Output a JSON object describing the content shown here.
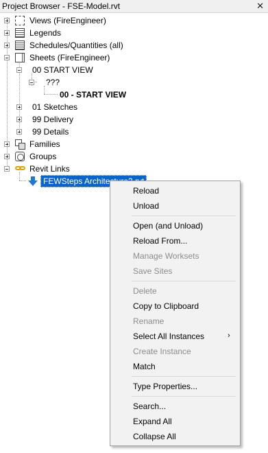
{
  "panel": {
    "title": "Project Browser - FSE-Model.rvt",
    "close_glyph": "✕"
  },
  "tree": {
    "views": "Views (FireEngineer)",
    "legends": "Legends",
    "schedules": "Schedules/Quantities (all)",
    "sheets": "Sheets (FireEngineer)",
    "sheet_group_start": "00 START VIEW",
    "sheet_unknown": "???",
    "sheet_start_view": "00 - START VIEW",
    "sheet_sketches": "01 Sketches",
    "sheet_delivery": "99 Delivery",
    "sheet_details": "99 Details",
    "families": "Families",
    "groups": "Groups",
    "revit_links": "Revit Links",
    "selected_link": "FEWSteps Architecture2.rvt"
  },
  "icons": {
    "views": "views-icon",
    "legends": "legends-icon",
    "schedules": "schedules-icon",
    "sheets": "sheets-icon",
    "families": "families-icon",
    "groups": "groups-icon",
    "revit_links": "link-chain-icon",
    "link_item": "blue-down-arrow-icon"
  },
  "context_menu": {
    "reload": "Reload",
    "unload": "Unload",
    "open_unload": "Open (and Unload)",
    "reload_from": "Reload From...",
    "manage_worksets": "Manage Worksets",
    "save_sites": "Save Sites",
    "delete": "Delete",
    "copy_clipboard": "Copy to Clipboard",
    "rename": "Rename",
    "select_all_instances": "Select All Instances",
    "submenu_arrow": "›",
    "create_instance": "Create Instance",
    "match": "Match",
    "type_properties": "Type Properties...",
    "search": "Search...",
    "expand_all": "Expand All",
    "collapse_all": "Collapse All"
  },
  "colors": {
    "selection": "#0a64c8",
    "link_chain": "#d6a800",
    "link_arrow": "#1e78d7",
    "disabled_text": "#8c8c8c"
  }
}
